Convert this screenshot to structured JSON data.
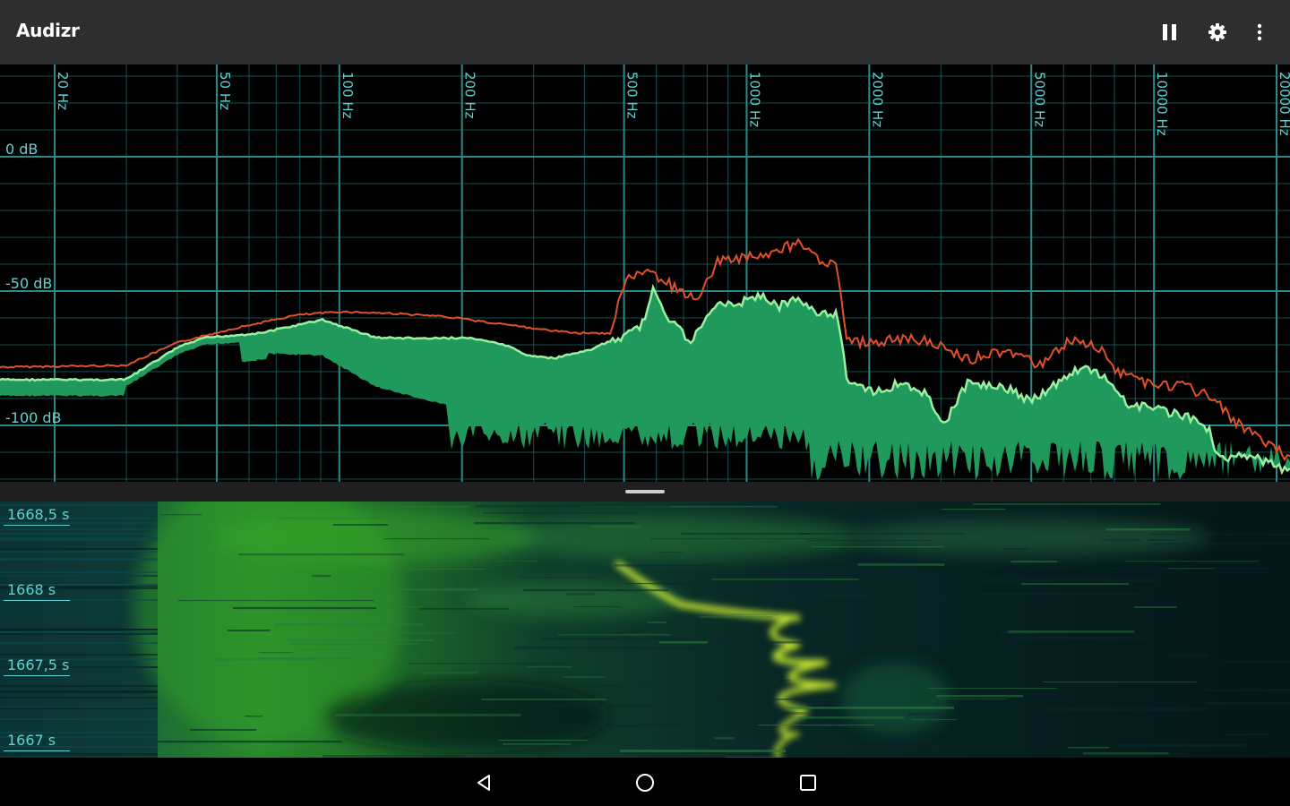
{
  "app": {
    "title": "Audizr"
  },
  "toolbar": {
    "actions": [
      "pause-icon",
      "gear-icon",
      "more-vert-icon"
    ]
  },
  "spectrum": {
    "freq_labels": [
      "20 Hz",
      "50 Hz",
      "100 Hz",
      "200 Hz",
      "500 Hz",
      "1000 Hz",
      "2000 Hz",
      "5000 Hz",
      "10000 Hz",
      "20000 Hz"
    ],
    "db_labels": [
      "0 dB",
      "-50 dB",
      "-100 dB"
    ],
    "colors": {
      "grid": "#1b6b6b",
      "label": "#5fd3d1",
      "fill": "#1f9a5c",
      "peak": "#e0502a",
      "current": "#9af0a0"
    }
  },
  "spectrogram": {
    "time_labels": [
      "1668,5 s",
      "1668 s",
      "1667,5 s",
      "1667 s"
    ]
  },
  "navbar": {
    "buttons": [
      "back-icon",
      "home-icon",
      "recents-icon"
    ]
  }
}
